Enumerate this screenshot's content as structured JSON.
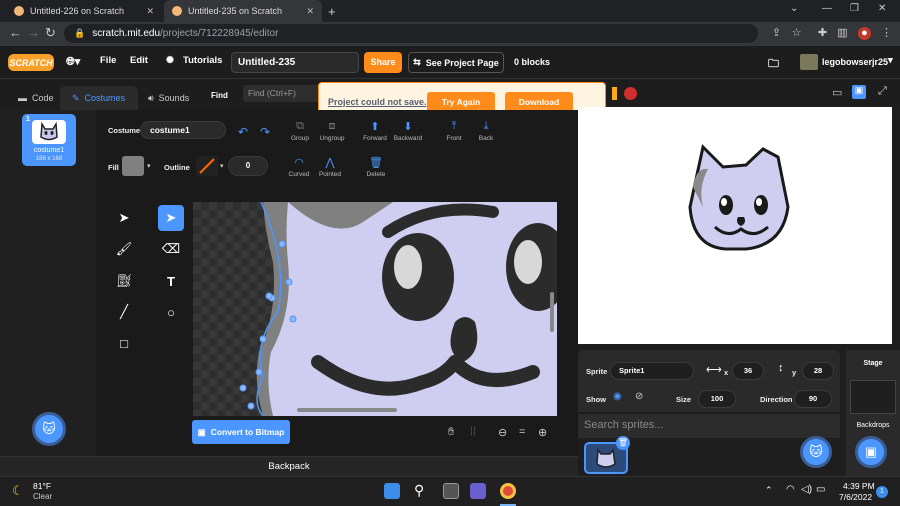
{
  "browser": {
    "tabs": [
      {
        "title": "Untitled-226 on Scratch",
        "active": false
      },
      {
        "title": "Untitled-235 on Scratch",
        "active": true
      }
    ],
    "url_host": "scratch.mit.edu",
    "url_path": "/projects/712228945/editor"
  },
  "menu": {
    "logo": "SCRATCH",
    "file": "File",
    "edit": "Edit",
    "tutorials": "Tutorials",
    "project_title": "Untitled-235",
    "share": "Share",
    "see_project_page": "See Project Page",
    "blocks": "0 blocks",
    "username": "legobowserjr25"
  },
  "editor_tabs": {
    "code": "Code",
    "costumes": "Costumes",
    "sounds": "Sounds"
  },
  "find": {
    "label": "Find",
    "placeholder": "Find (Ctrl+F)"
  },
  "dialog": {
    "message": "Project could not save.",
    "try_again": "Try Again",
    "download": "Download"
  },
  "costume_list": [
    {
      "number": "1",
      "name": "costume1",
      "size": "166 x 168"
    }
  ],
  "paint": {
    "costume_label": "Costume",
    "costume_name": "costume1",
    "fill_label": "Fill",
    "outline_label": "Outline",
    "outline_width": "0",
    "fill_color": "#808080",
    "outline_color": "#ff6600",
    "tools_top": [
      "Group",
      "Ungroup",
      "Forward",
      "Backward",
      "Front",
      "Back"
    ],
    "tools_second": [
      "Curved",
      "Pointed",
      "Delete"
    ],
    "convert": "Convert to Bitmap",
    "zoom_reset": "="
  },
  "backpack": "Backpack",
  "sprite": {
    "sprite_label": "Sprite",
    "name": "Sprite1",
    "x_label": "x",
    "x": "36",
    "y_label": "y",
    "y": "28",
    "show_label": "Show",
    "size_label": "Size",
    "size": "100",
    "direction_label": "Direction",
    "direction": "90",
    "search_placeholder": "Search sprites..."
  },
  "stage_pane": {
    "title": "Stage",
    "backdrops": "Backdrops"
  },
  "taskbar": {
    "temp": "81°F",
    "weather": "Clear",
    "time": "4:39 PM",
    "date": "7/6/2022",
    "badge": "1"
  }
}
